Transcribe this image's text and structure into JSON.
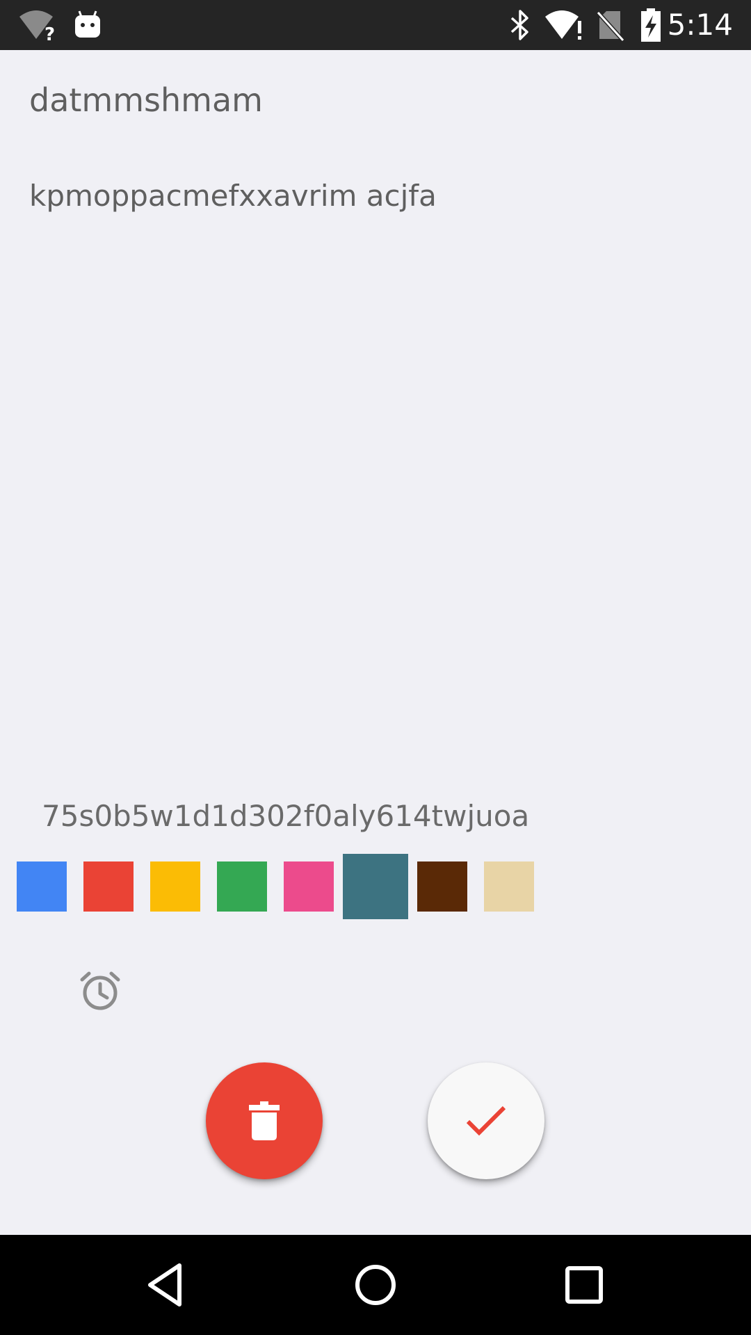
{
  "status_bar": {
    "time": "5:14",
    "icons": [
      "wifi-unknown-icon",
      "android-icon",
      "bluetooth-icon",
      "wifi-alert-icon",
      "no-sim-icon",
      "battery-charging-icon"
    ]
  },
  "note": {
    "title": "datmmshmam",
    "body": "kpmoppacmefxxavrim acjfa",
    "tag": "75s0b5w1d1d302f0aly614twjuoa"
  },
  "color_picker": {
    "swatches": [
      {
        "name": "blue",
        "color": "#4285f4",
        "selected": false
      },
      {
        "name": "red",
        "color": "#ea4335",
        "selected": false
      },
      {
        "name": "yellow",
        "color": "#fbbc05",
        "selected": false
      },
      {
        "name": "green",
        "color": "#34a853",
        "selected": false
      },
      {
        "name": "pink",
        "color": "#ec4b8c",
        "selected": false
      },
      {
        "name": "teal",
        "color": "#3d7381",
        "selected": true
      },
      {
        "name": "brown",
        "color": "#5a2906",
        "selected": false
      },
      {
        "name": "beige",
        "color": "#e8d4a6",
        "selected": false
      }
    ]
  },
  "actions": {
    "alarm_icon": "alarm-clock-icon",
    "delete_icon": "trash-icon",
    "done_icon": "check-icon",
    "delete_color": "#ea4335",
    "done_check_color": "#ea4335"
  },
  "nav_bar": {
    "icons": [
      "back-icon",
      "home-icon",
      "recents-icon"
    ]
  }
}
